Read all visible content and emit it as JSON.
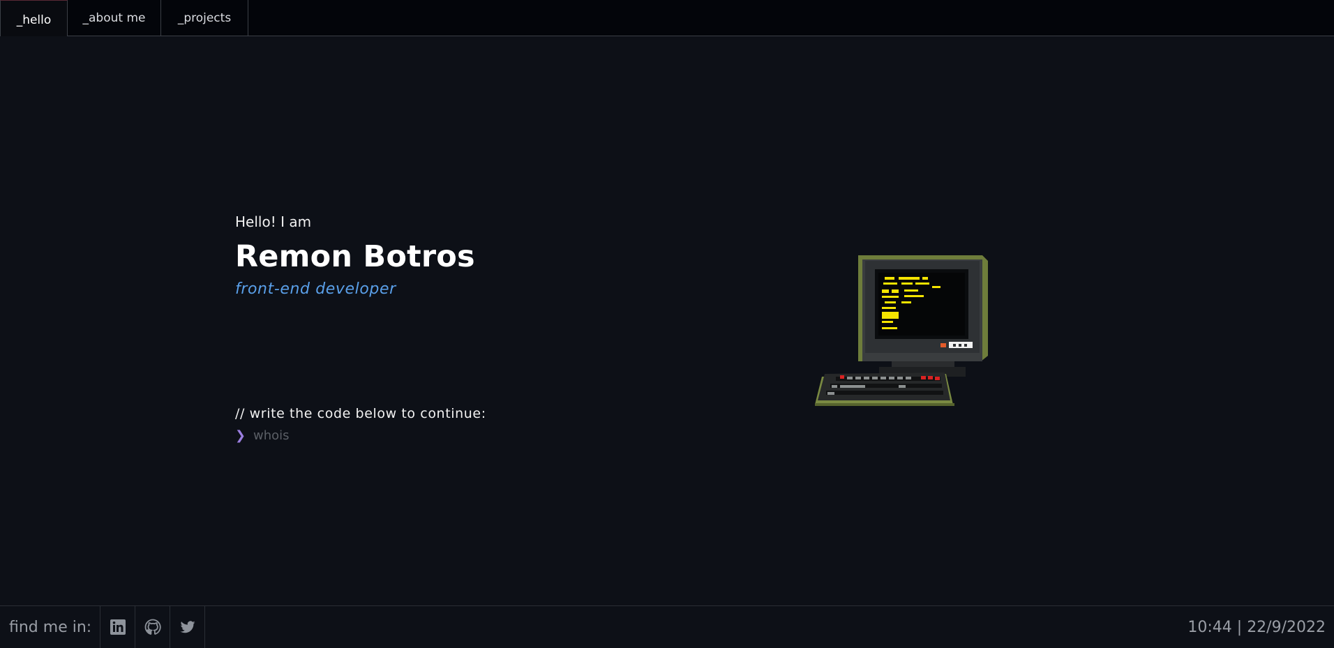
{
  "nav": {
    "tabs": [
      {
        "label": "_hello",
        "active": true
      },
      {
        "label": "_about me",
        "active": false
      },
      {
        "label": "_projects",
        "active": false
      }
    ]
  },
  "hero": {
    "greeting": "Hello! I am",
    "name": "Remon Botros",
    "role": "front-end developer"
  },
  "prompt": {
    "comment": "//  write the code below to continue:",
    "symbol": "❯",
    "placeholder": "whois",
    "value": ""
  },
  "illustration": {
    "icon": "retro-computer-icon",
    "screen_text_color": "#f5e400",
    "case_color": "#6b7a3a"
  },
  "footer": {
    "find_label": "find me in:",
    "socials": [
      {
        "icon": "linkedin-icon"
      },
      {
        "icon": "github-icon"
      },
      {
        "icon": "twitter-icon"
      }
    ],
    "clock": "10:44 | 22/9/2022"
  },
  "colors": {
    "background": "#0d1017",
    "nav_background": "#03050a",
    "accent_role": "#5aa0ea",
    "prompt_chevron": "#9b7fe0"
  }
}
